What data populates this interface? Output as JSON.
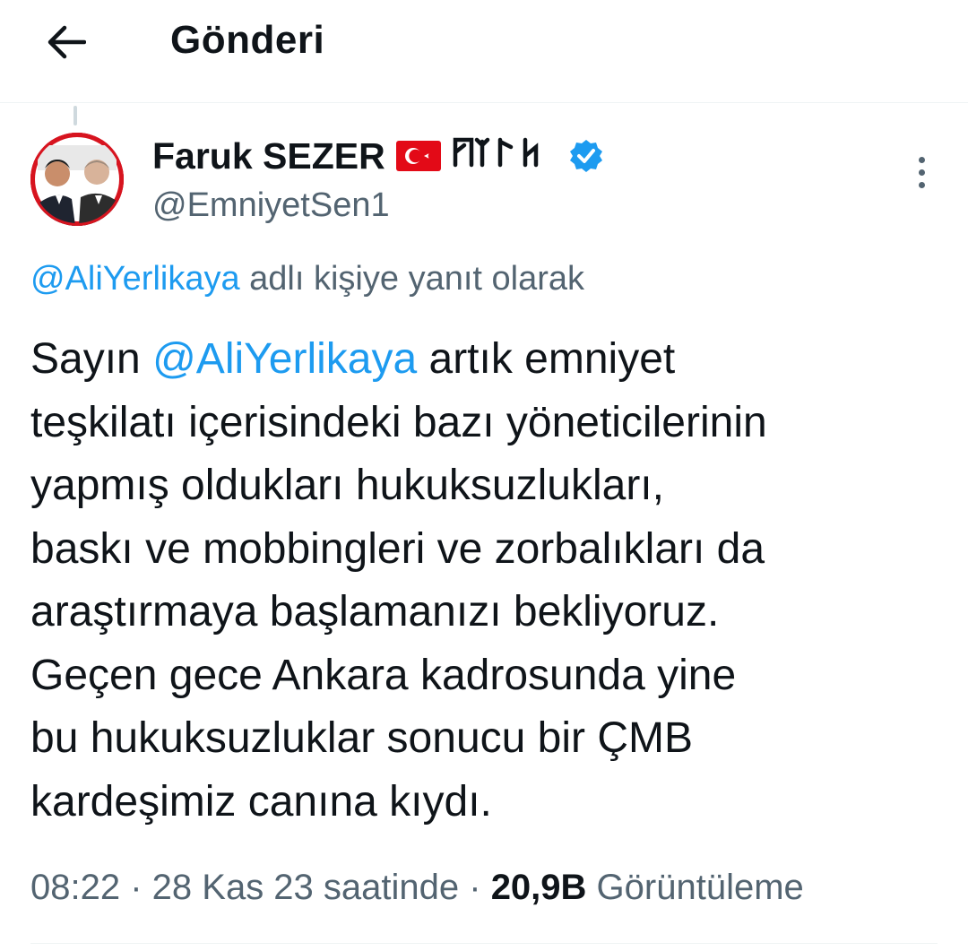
{
  "header": {
    "title": "Gönderi",
    "back_icon": "arrow-left-icon"
  },
  "author": {
    "name": "Faruk SEZER",
    "flag_icon": "turkish-flag-icon",
    "runes": "𐰀𐱃𐰢𐰴",
    "verified_icon": "verified-badge-icon",
    "handle": "@EmniyetSen1"
  },
  "reply_context": {
    "mention": "@AliYerlikaya",
    "text": " adlı kişiye yanıt olarak"
  },
  "tweet": {
    "lines": [
      {
        "pre": "Sayın ",
        "mention": "@AliYerlikaya",
        "post": " artık emniyet"
      },
      {
        "text": "teşkilatı içerisindeki bazı yöneticilerinin"
      },
      {
        "text": "yapmış oldukları hukuksuzlukları,"
      },
      {
        "text": "baskı ve mobbingleri ve zorbalıkları da"
      },
      {
        "text": "araştırmaya başlamanızı bekliyoruz."
      },
      {
        "text": "Geçen gece Ankara kadrosunda yine"
      },
      {
        "text": "bu hukuksuzluklar sonucu bir ÇMB"
      },
      {
        "text": "kardeşimiz canına kıydı."
      }
    ]
  },
  "meta": {
    "time": "08:22",
    "separator": " · ",
    "date": "28 Kas 23 saatinde",
    "views_count": "20,9B",
    "views_label": " Görüntüleme"
  },
  "colors": {
    "accent": "#1d9bf0",
    "secondary_text": "#536471",
    "primary_text": "#0f1419"
  }
}
